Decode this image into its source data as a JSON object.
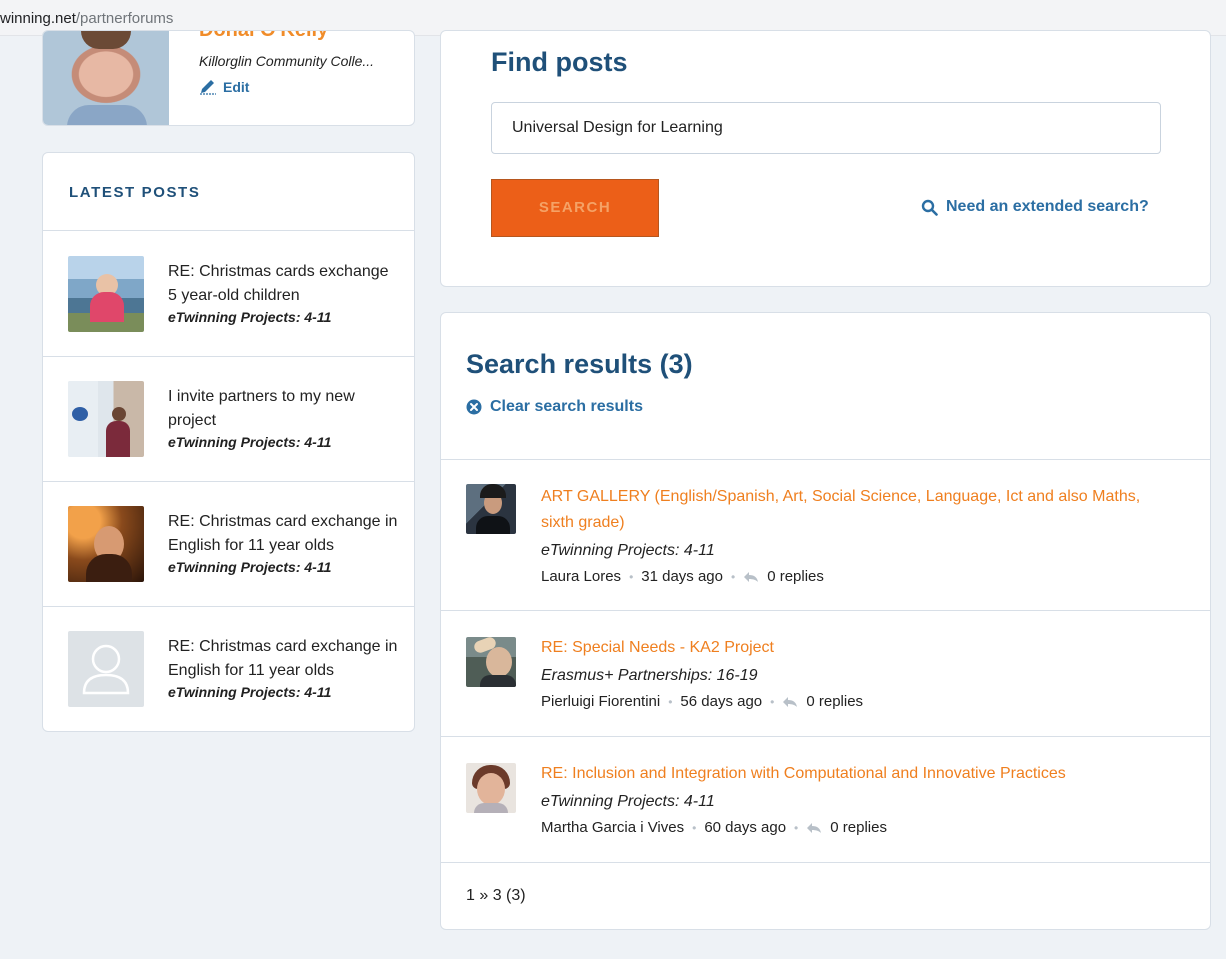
{
  "browser": {
    "url_domain": "winning.net",
    "url_path": "/partnerforums"
  },
  "profile": {
    "name": "Donal O'Kelly",
    "school": "Killorglin Community Colle...",
    "edit_label": "Edit"
  },
  "latest_posts": {
    "heading": "LATEST POSTS",
    "items": [
      {
        "title": "RE: Christmas cards exchange 5 year-old children",
        "forum": "eTwinning Projects: 4-11"
      },
      {
        "title": "I invite partners to my new project",
        "forum": "eTwinning Projects: 4-11"
      },
      {
        "title": "RE: Christmas card exchange in English for 11 year olds",
        "forum": "eTwinning Projects: 4-11"
      },
      {
        "title": "RE: Christmas card exchange in English for 11 year olds",
        "forum": "eTwinning Projects: 4-11"
      }
    ]
  },
  "find": {
    "title": "Find posts",
    "query": "Universal Design for Learning",
    "search_label": "SEARCH",
    "extended_label": "Need an extended search?"
  },
  "results": {
    "title": "Search results (3)",
    "clear_label": "Clear search results",
    "items": [
      {
        "title": "ART GALLERY (English/Spanish, Art, Social Science, Language, Ict and also Maths, sixth grade)",
        "forum": "eTwinning Projects: 4-11",
        "author": "Laura Lores",
        "age": "31 days ago",
        "replies": "0 replies"
      },
      {
        "title": "RE: Special Needs - KA2 Project",
        "forum": "Erasmus+ Partnerships: 16-19",
        "author": "Pierluigi Fiorentini",
        "age": "56 days ago",
        "replies": "0 replies"
      },
      {
        "title": "RE: Inclusion and Integration with Computational and Innovative Practices",
        "forum": "eTwinning Projects: 4-11",
        "author": "Martha Garcia i Vives",
        "age": "60 days ago",
        "replies": "0 replies"
      }
    ],
    "pagination": "1 » 3 (3)"
  }
}
